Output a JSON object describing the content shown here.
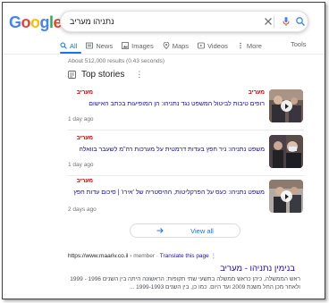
{
  "search": {
    "query": "נתניהו מעריב"
  },
  "tabs": [
    {
      "label": "All"
    },
    {
      "label": "News"
    },
    {
      "label": "Images"
    },
    {
      "label": "Maps"
    },
    {
      "label": "Videos"
    },
    {
      "label": "More"
    }
  ],
  "tools_label": "Tools",
  "stats": "About 512,000 results (0.43 seconds)",
  "top_stories": {
    "title": "Top stories",
    "items": [
      {
        "source": "מעריב",
        "headline": "רופים טיבות לביטול המשפט נגד נתניהו: הן המופיעות בכתב האישום",
        "age": "1 day ago"
      },
      {
        "source": "מעריב",
        "headline": "משפט נתניהו: ניר חפץ בעדות דרמטית על מערכות רה\"מ לשעבר בוואלה",
        "age": "1 day ago"
      },
      {
        "source": "מעריב",
        "headline": "משפט נתניהו: כעס על הפרקליטות, ההיסטריה של 'אירו' | סיכום עדות חפץ",
        "age": "2 days ago"
      }
    ],
    "view_all": "View all"
  },
  "result": {
    "url": "https://www.maariv.co.il",
    "member": "› member",
    "translate": "Translate this page",
    "title": "בנימין נתניהו - מעריב",
    "snippet": "ראש הממשלה, כיהן כראש ממשלה בתשעי שתי תקופות: הראשונה היתה בין השנים 1996 - 1999 ולאחר מכן החל משנת 2009 ועד היום. כמו כן, בין השנים 1999-1993 ..."
  },
  "colors": {
    "accent": "#1a73e8",
    "link": "#1a0dab",
    "source_red": "#d90000"
  },
  "icons": [
    "search-icon",
    "clear-icon",
    "mic-icon",
    "news-icon",
    "images-icon",
    "maps-icon",
    "videos-icon",
    "more-icon",
    "top-stories-icon",
    "arrow-right-icon",
    "play-icon"
  ]
}
